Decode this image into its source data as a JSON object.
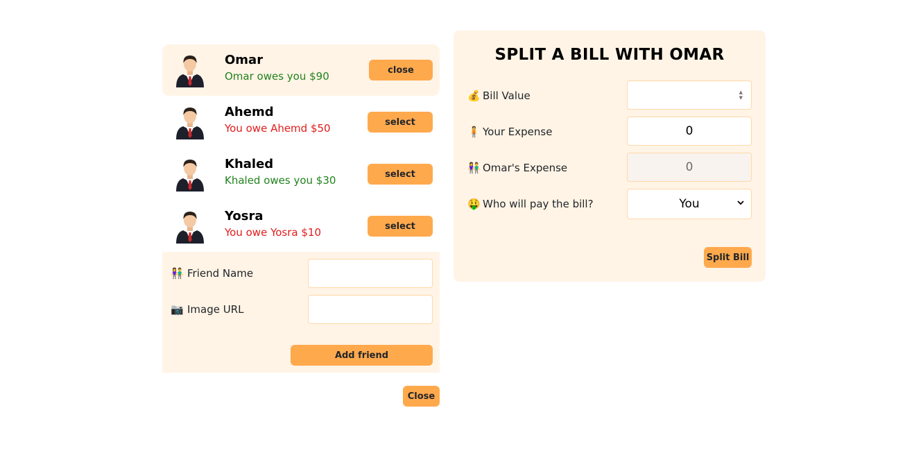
{
  "friends": [
    {
      "name": "Omar",
      "status": "Omar owes you $90",
      "status_color": "#22821e",
      "button_label": "close",
      "selected": true
    },
    {
      "name": "Ahemd",
      "status": "You owe Ahemd $50",
      "status_color": "#e21b1b",
      "button_label": "select",
      "selected": false
    },
    {
      "name": "Khaled",
      "status": "Khaled owes you $30",
      "status_color": "#22821e",
      "button_label": "select",
      "selected": false
    },
    {
      "name": "Yosra",
      "status": "You owe Yosra $10",
      "status_color": "#e21b1b",
      "button_label": "select",
      "selected": false
    }
  ],
  "add_friend": {
    "name_label": "Friend Name",
    "name_icon": "👫",
    "name_value": "",
    "image_label": "Image URL",
    "image_icon": "📷",
    "image_value": "",
    "submit_label": "Add friend"
  },
  "close_label": "Close",
  "split": {
    "title": "SPLIT A BILL WITH OMAR",
    "bill_label": "Bill Value",
    "bill_icon": "💰",
    "bill_value": "",
    "your_label": "Your Expense",
    "your_icon": "🧍",
    "your_value": "0",
    "friend_label": "Omar's Expense",
    "friend_icon": "👫",
    "friend_value": "0",
    "payer_label": "Who will pay the bill?",
    "payer_icon": "🤑",
    "payer_value": "You",
    "submit_label": "Split Bill"
  },
  "colors": {
    "accent": "#ffa94d",
    "panel": "#fff4e6",
    "owes_you": "#22821e",
    "you_owe": "#e21b1b"
  }
}
